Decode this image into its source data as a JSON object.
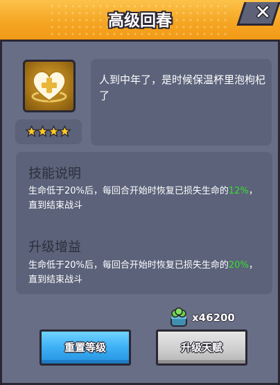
{
  "title": "高级回春",
  "close_label": "✕",
  "skill": {
    "icon": "heart-plus-icon",
    "stars": 4,
    "description": "人到中年了，是时候保温杯里泡枸杞了"
  },
  "skill_info": {
    "heading": "技能说明",
    "text_pre": "生命低于20%后，每回合开始时恢复已损失生命的",
    "highlight": "12%",
    "text_post": "，直到结束战斗"
  },
  "upgrade_info": {
    "heading": "升级增益",
    "text_pre": "生命低于20%后，每回合开始时恢复已损失生命的",
    "highlight": "20%",
    "text_post": "，直到结束战斗"
  },
  "cost": {
    "icon": "clover-jar-icon",
    "amount": "x46200"
  },
  "buttons": {
    "reset": "重置等级",
    "upgrade": "升级天赋"
  },
  "colors": {
    "title_bar": "#f5a623",
    "panel": "#5b627a",
    "highlight": "#37e02a",
    "reset_button": "#3db0f5",
    "upgrade_button": "#cfcfcf"
  }
}
